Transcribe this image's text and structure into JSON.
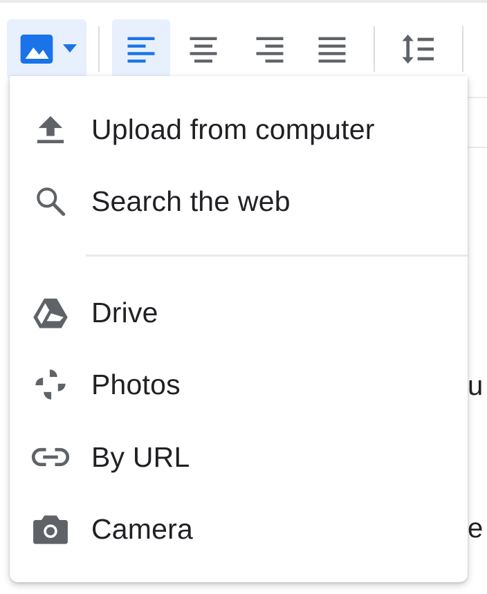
{
  "menu": {
    "items": [
      {
        "label": "Upload from computer",
        "icon": "upload-icon"
      },
      {
        "label": "Search the web",
        "icon": "search-icon"
      },
      {
        "label": "Drive",
        "icon": "drive-icon"
      },
      {
        "label": "Photos",
        "icon": "photos-icon"
      },
      {
        "label": "By URL",
        "icon": "link-icon"
      },
      {
        "label": "Camera",
        "icon": "camera-icon"
      }
    ]
  },
  "background_text": {
    "fragment_1": "u",
    "fragment_2": "e"
  },
  "colors": {
    "accent": "#1a73e8",
    "active_bg": "#e8f0fe",
    "icon_gray": "#5f6368",
    "text": "#202124"
  }
}
